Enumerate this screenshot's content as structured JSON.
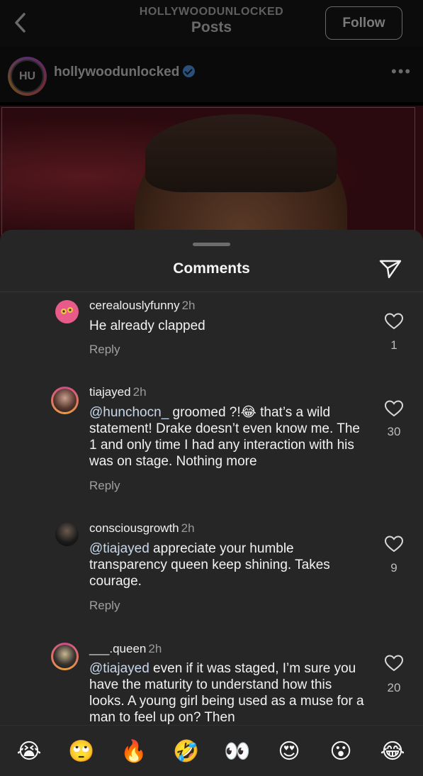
{
  "header": {
    "account": "HOLLYWOODUNLOCKED",
    "title": "Posts",
    "follow_label": "Follow"
  },
  "post": {
    "username": "hollywoodunlocked",
    "avatar_initials": "HU"
  },
  "sheet": {
    "title": "Comments"
  },
  "comments": [
    {
      "username": "cerealouslyfunny",
      "time": "2h",
      "text": "He already clapped",
      "reply": "Reply",
      "likes": "1"
    },
    {
      "username": "tiajayed",
      "time": "2h",
      "mention": "@hunchocn_",
      "text": " groomed ?!😂 that’s a wild statement! Drake doesn’t even know me. The 1 and only time I had any interaction with his was on stage. Nothing more",
      "reply": "Reply",
      "likes": "30"
    },
    {
      "username": "consciousgrowth",
      "time": "2h",
      "mention": "@tiajayed",
      "text": " appreciate your humble transparency queen keep shining. Takes courage.",
      "reply": "Reply",
      "likes": "9"
    },
    {
      "username": "___.queen",
      "time": "2h",
      "mention": "@tiajayed",
      "text": " even if it was staged, I’m sure you have the maturity to understand how this looks. A young girl being used as a muse for a man to feel up on? Then",
      "likes": "20"
    }
  ],
  "emoji_bar": [
    "😭",
    "🙄",
    "🔥",
    "🤣",
    "👀",
    "😍",
    "😮",
    "😂"
  ],
  "colors": {
    "sheet_bg": "#262626",
    "mention": "#c9d8ea",
    "verified": "#2a4f7a"
  }
}
